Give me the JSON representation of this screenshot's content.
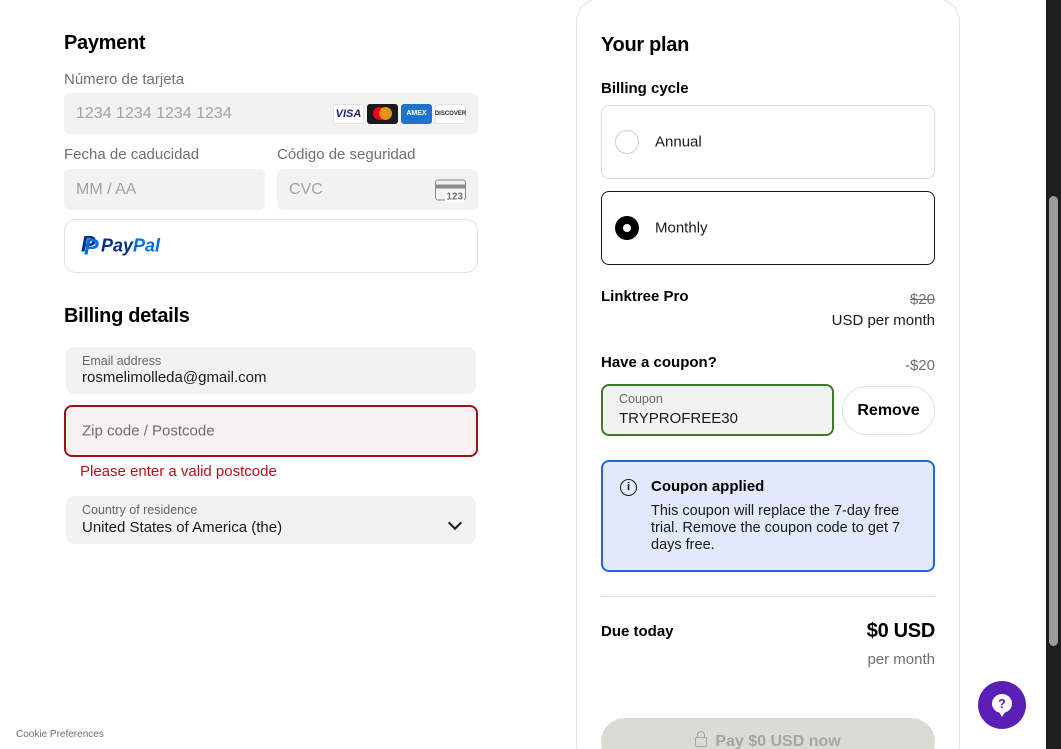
{
  "payment": {
    "title": "Payment",
    "card_number": {
      "label": "Número de tarjeta",
      "placeholder": "1234 1234 1234 1234"
    },
    "card_brands": [
      "VISA",
      "mastercard",
      "AMEX",
      "DISCOVER"
    ],
    "expiry": {
      "label": "Fecha de caducidad",
      "placeholder": "MM / AA"
    },
    "cvc": {
      "label": "Código de seguridad",
      "placeholder": "CVC",
      "icon_text": "123"
    },
    "paypal": {
      "pay": "Pay",
      "pal": "Pal"
    }
  },
  "billing": {
    "title": "Billing details",
    "email": {
      "label": "Email address",
      "value": "rosmelimolleda@gmail.com"
    },
    "zip": {
      "placeholder": "Zip code / Postcode",
      "error": "Please enter a valid postcode"
    },
    "country": {
      "label": "Country of residence",
      "value": "United States of America (the)"
    }
  },
  "footer": {
    "cookie": "Cookie Preferences"
  },
  "plan": {
    "title": "Your plan",
    "billing_cycle_label": "Billing cycle",
    "options": [
      {
        "label": "Annual",
        "selected": false
      },
      {
        "label": "Monthly",
        "selected": true
      }
    ],
    "product": {
      "name": "Linktree Pro",
      "original_price": "$20",
      "price_unit": "USD per month"
    },
    "coupon": {
      "question": "Have a coupon?",
      "discount": "-$20",
      "field_label": "Coupon",
      "value": "TRYPROFREE30",
      "remove_label": "Remove"
    },
    "notice": {
      "title": "Coupon applied",
      "body": "This coupon will replace the 7-day free trial. Remove the coupon code to get 7 days free."
    },
    "due": {
      "label": "Due today",
      "amount": "$0 USD",
      "sub": "per month"
    },
    "pay_button": "Pay $0 USD now"
  },
  "colors": {
    "error": "#b3111c",
    "coupon_border": "#3d7a2c",
    "notice_border": "#2665d6",
    "notice_bg": "#e2e9fb",
    "help_button": "#5b1fb6"
  },
  "icons": [
    "card-icon",
    "paypal-icon",
    "chevron-down-icon",
    "info-icon",
    "lock-icon",
    "help-icon"
  ]
}
